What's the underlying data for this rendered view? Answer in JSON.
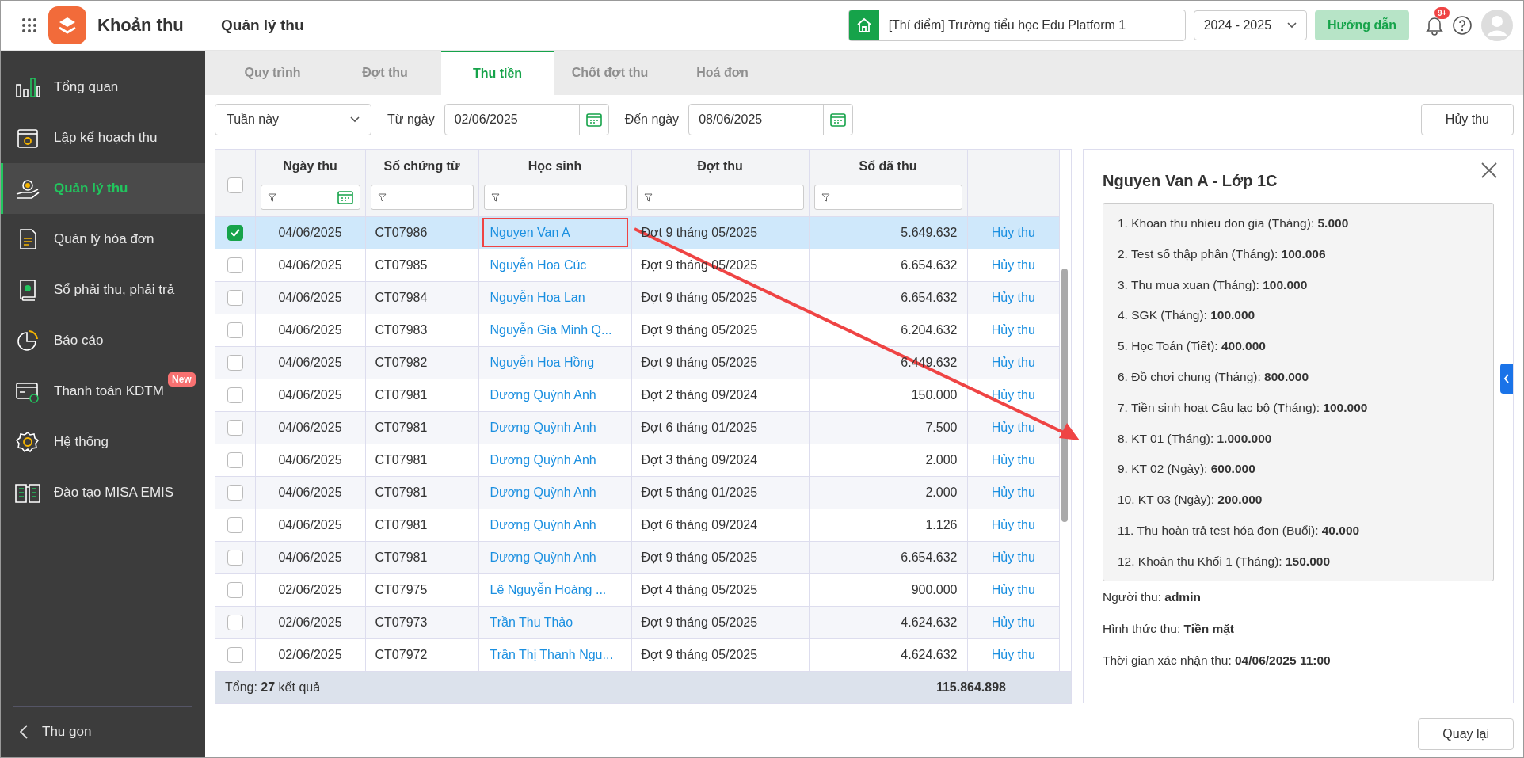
{
  "app": {
    "title": "Khoản thu"
  },
  "header": {
    "page_title": "Quản lý thu",
    "school": "[Thí điểm] Trường tiểu học Edu Platform 1",
    "year": "2024 - 2025",
    "guide_button": "Hướng dẫn",
    "notification_badge": "9+"
  },
  "sidebar": {
    "items": [
      {
        "label": "Tổng quan",
        "selected": false
      },
      {
        "label": "Lập kế hoạch thu",
        "selected": false
      },
      {
        "label": "Quản lý thu",
        "selected": true
      },
      {
        "label": "Quản lý hóa đơn",
        "selected": false
      },
      {
        "label": "Sổ phải thu, phải trả",
        "selected": false
      },
      {
        "label": "Báo cáo",
        "selected": false
      },
      {
        "label": "Thanh toán KDTM",
        "selected": false,
        "badge": "New"
      },
      {
        "label": "Hệ thống",
        "selected": false
      },
      {
        "label": "Đào tạo MISA EMIS",
        "selected": false
      }
    ],
    "collapse": "Thu gọn"
  },
  "tabs": [
    {
      "label": "Quy trình",
      "selected": false
    },
    {
      "label": "Đợt thu",
      "selected": false
    },
    {
      "label": "Thu tiền",
      "selected": true
    },
    {
      "label": "Chốt đợt thu",
      "selected": false
    },
    {
      "label": "Hoá đơn",
      "selected": false
    }
  ],
  "filters": {
    "period": "Tuần này",
    "from_label": "Từ ngày",
    "from": "02/06/2025",
    "to_label": "Đến ngày",
    "to": "08/06/2025",
    "cancel_button": "Hủy thu"
  },
  "table": {
    "select_all": false,
    "columns": [
      "Ngày thu",
      "Số chứng từ",
      "Học sinh",
      "Đợt thu",
      "Số đã thu"
    ],
    "rows": [
      {
        "checked": true,
        "selected": true,
        "highlighted": true,
        "date": "04/06/2025",
        "voucher": "CT07986",
        "student": "Nguyen Van A",
        "batch": "Đợt 9 tháng 05/2025",
        "amount": "5.649.632",
        "action": "Hủy thu"
      },
      {
        "checked": false,
        "selected": false,
        "highlighted": false,
        "date": "04/06/2025",
        "voucher": "CT07985",
        "student": "Nguyễn Hoa Cúc",
        "batch": "Đợt 9 tháng 05/2025",
        "amount": "6.654.632",
        "action": "Hủy thu"
      },
      {
        "checked": false,
        "selected": false,
        "highlighted": false,
        "date": "04/06/2025",
        "voucher": "CT07984",
        "student": "Nguyễn Hoa Lan",
        "batch": "Đợt 9 tháng 05/2025",
        "amount": "6.654.632",
        "action": "Hủy thu"
      },
      {
        "checked": false,
        "selected": false,
        "highlighted": false,
        "date": "04/06/2025",
        "voucher": "CT07983",
        "student": "Nguyễn Gia Minh Q...",
        "batch": "Đợt 9 tháng 05/2025",
        "amount": "6.204.632",
        "action": "Hủy thu"
      },
      {
        "checked": false,
        "selected": false,
        "highlighted": false,
        "date": "04/06/2025",
        "voucher": "CT07982",
        "student": "Nguyễn Hoa Hồng",
        "batch": "Đợt 9 tháng 05/2025",
        "amount": "6.449.632",
        "action": "Hủy thu"
      },
      {
        "checked": false,
        "selected": false,
        "highlighted": false,
        "date": "04/06/2025",
        "voucher": "CT07981",
        "student": "Dương Quỳnh Anh",
        "batch": "Đợt 2 tháng 09/2024",
        "amount": "150.000",
        "action": "Hủy thu"
      },
      {
        "checked": false,
        "selected": false,
        "highlighted": false,
        "date": "04/06/2025",
        "voucher": "CT07981",
        "student": "Dương Quỳnh Anh",
        "batch": "Đợt 6 tháng 01/2025",
        "amount": "7.500",
        "action": "Hủy thu"
      },
      {
        "checked": false,
        "selected": false,
        "highlighted": false,
        "date": "04/06/2025",
        "voucher": "CT07981",
        "student": "Dương Quỳnh Anh",
        "batch": "Đợt 3 tháng 09/2024",
        "amount": "2.000",
        "action": "Hủy thu"
      },
      {
        "checked": false,
        "selected": false,
        "highlighted": false,
        "date": "04/06/2025",
        "voucher": "CT07981",
        "student": "Dương Quỳnh Anh",
        "batch": "Đợt 5 tháng 01/2025",
        "amount": "2.000",
        "action": "Hủy thu"
      },
      {
        "checked": false,
        "selected": false,
        "highlighted": false,
        "date": "04/06/2025",
        "voucher": "CT07981",
        "student": "Dương Quỳnh Anh",
        "batch": "Đợt 6 tháng 09/2024",
        "amount": "1.126",
        "action": "Hủy thu"
      },
      {
        "checked": false,
        "selected": false,
        "highlighted": false,
        "date": "04/06/2025",
        "voucher": "CT07981",
        "student": "Dương Quỳnh Anh",
        "batch": "Đợt 9 tháng 05/2025",
        "amount": "6.654.632",
        "action": "Hủy thu"
      },
      {
        "checked": false,
        "selected": false,
        "highlighted": false,
        "date": "02/06/2025",
        "voucher": "CT07975",
        "student": "Lê Nguyễn Hoàng ...",
        "batch": "Đợt 4 tháng 05/2025",
        "amount": "900.000",
        "action": "Hủy thu"
      },
      {
        "checked": false,
        "selected": false,
        "highlighted": false,
        "date": "02/06/2025",
        "voucher": "CT07973",
        "student": "Trần Thu Thảo",
        "batch": "Đợt 9 tháng 05/2025",
        "amount": "4.624.632",
        "action": "Hủy thu"
      },
      {
        "checked": false,
        "selected": false,
        "highlighted": false,
        "date": "02/06/2025",
        "voucher": "CT07972",
        "student": "Trần Thị Thanh Ngu...",
        "batch": "Đợt 9 tháng 05/2025",
        "amount": "4.624.632",
        "action": "Hủy thu"
      }
    ],
    "footer": {
      "label": "Tổng: **27** kết quả",
      "total": "115.864.898"
    }
  },
  "detail": {
    "title": "Nguyen Van A - Lớp 1C",
    "items": [
      "1. Khoan thu nhieu don gia (Tháng): **5.000**",
      "2. Test số thập phân (Tháng): **100.006**",
      "3. Thu mua xuan (Tháng): **100.000**",
      "4. SGK (Tháng): **100.000**",
      "5. Học Toán (Tiết): **400.000**",
      "6. Đồ chơi chung (Tháng): **800.000**",
      "7. Tiền sinh hoạt Câu lạc bộ (Tháng): **100.000**",
      "8. KT 01 (Tháng): **1.000.000**",
      "9. KT 02 (Ngày): **600.000**",
      "10. KT 03 (Ngày): **200.000**",
      "11. Thu hoàn trả test hóa đơn (Buổi): **40.000**",
      "12. Khoản thu Khối 1 (Tháng): **150.000**"
    ],
    "fields": [
      "Người thu: **admin**",
      "Hình thức thu: **Tiền mặt**",
      "Thời gian xác nhận thu: **04/06/2025 11:00**"
    ]
  },
  "back_button": "Quay lại"
}
